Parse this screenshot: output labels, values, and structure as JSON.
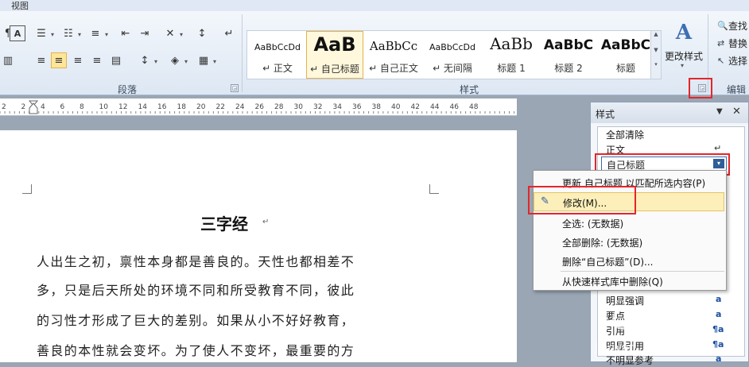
{
  "ribbon": {
    "tab_view": "视图",
    "groups": {
      "paragraph": "段落",
      "styles": "样式",
      "editing": "编辑"
    },
    "gallery": [
      {
        "preview": "AaBbCcDd",
        "name": "↵ 正文"
      },
      {
        "preview": "AaB",
        "name": "↵ 自己标题"
      },
      {
        "preview": "AaBbCc",
        "name": "↵ 自己正文"
      },
      {
        "preview": "AaBbCcDd",
        "name": "↵ 无间隔"
      },
      {
        "preview": "AaBb",
        "name": "标题 1"
      },
      {
        "preview": "AaBbC",
        "name": "标题 2"
      },
      {
        "preview": "AaBbC",
        "name": "标题"
      }
    ],
    "change_styles": "更改样式",
    "find": "查找",
    "replace": "替换",
    "select": "选择"
  },
  "ruler": {
    "numbers": [
      "2",
      "2",
      "4",
      "6",
      "8",
      "10",
      "12",
      "14",
      "16",
      "18",
      "20",
      "22",
      "24",
      "26",
      "28",
      "30",
      "32",
      "34",
      "36",
      "38",
      "40",
      "42",
      "44",
      "46",
      "48"
    ]
  },
  "document": {
    "title": "三字经",
    "lines": [
      "人出生之初，禀性本身都是善良的。天性也都相差不",
      "多，只是后天所处的环境不同和所受教育不同，彼此",
      "的习性才形成了巨大的差别。如果从小不好好教育，",
      "善良的本性就会变坏。为了使人不变坏，最重要的方"
    ]
  },
  "styles_pane": {
    "title": "样式",
    "items": [
      {
        "label": "全部清除",
        "mark": ""
      },
      {
        "label": "正文",
        "mark": "↵"
      },
      {
        "label": "自己标题",
        "mark": ""
      },
      {
        "label": "明显强调",
        "mark": "a"
      },
      {
        "label": "要点",
        "mark": "a"
      },
      {
        "label": "引用",
        "mark": "¶a"
      },
      {
        "label": "明显引用",
        "mark": "¶a"
      },
      {
        "label": "不明显参考",
        "mark": "a"
      }
    ]
  },
  "context_menu": {
    "items": [
      "更新 自己标题 以匹配所选内容(P)",
      "修改(M)...",
      "全选: (无数据)",
      "全部删除: (无数据)",
      "删除“自己标题”(D)...",
      "从快速样式库中删除(Q)"
    ]
  },
  "watermark": {
    "brand": "经验",
    "url": "jingyan"
  },
  "colors": {
    "highlight_red": "#e3262a",
    "menu_selected": "#fcefb9",
    "ribbon_bg": "#dde7f3"
  }
}
